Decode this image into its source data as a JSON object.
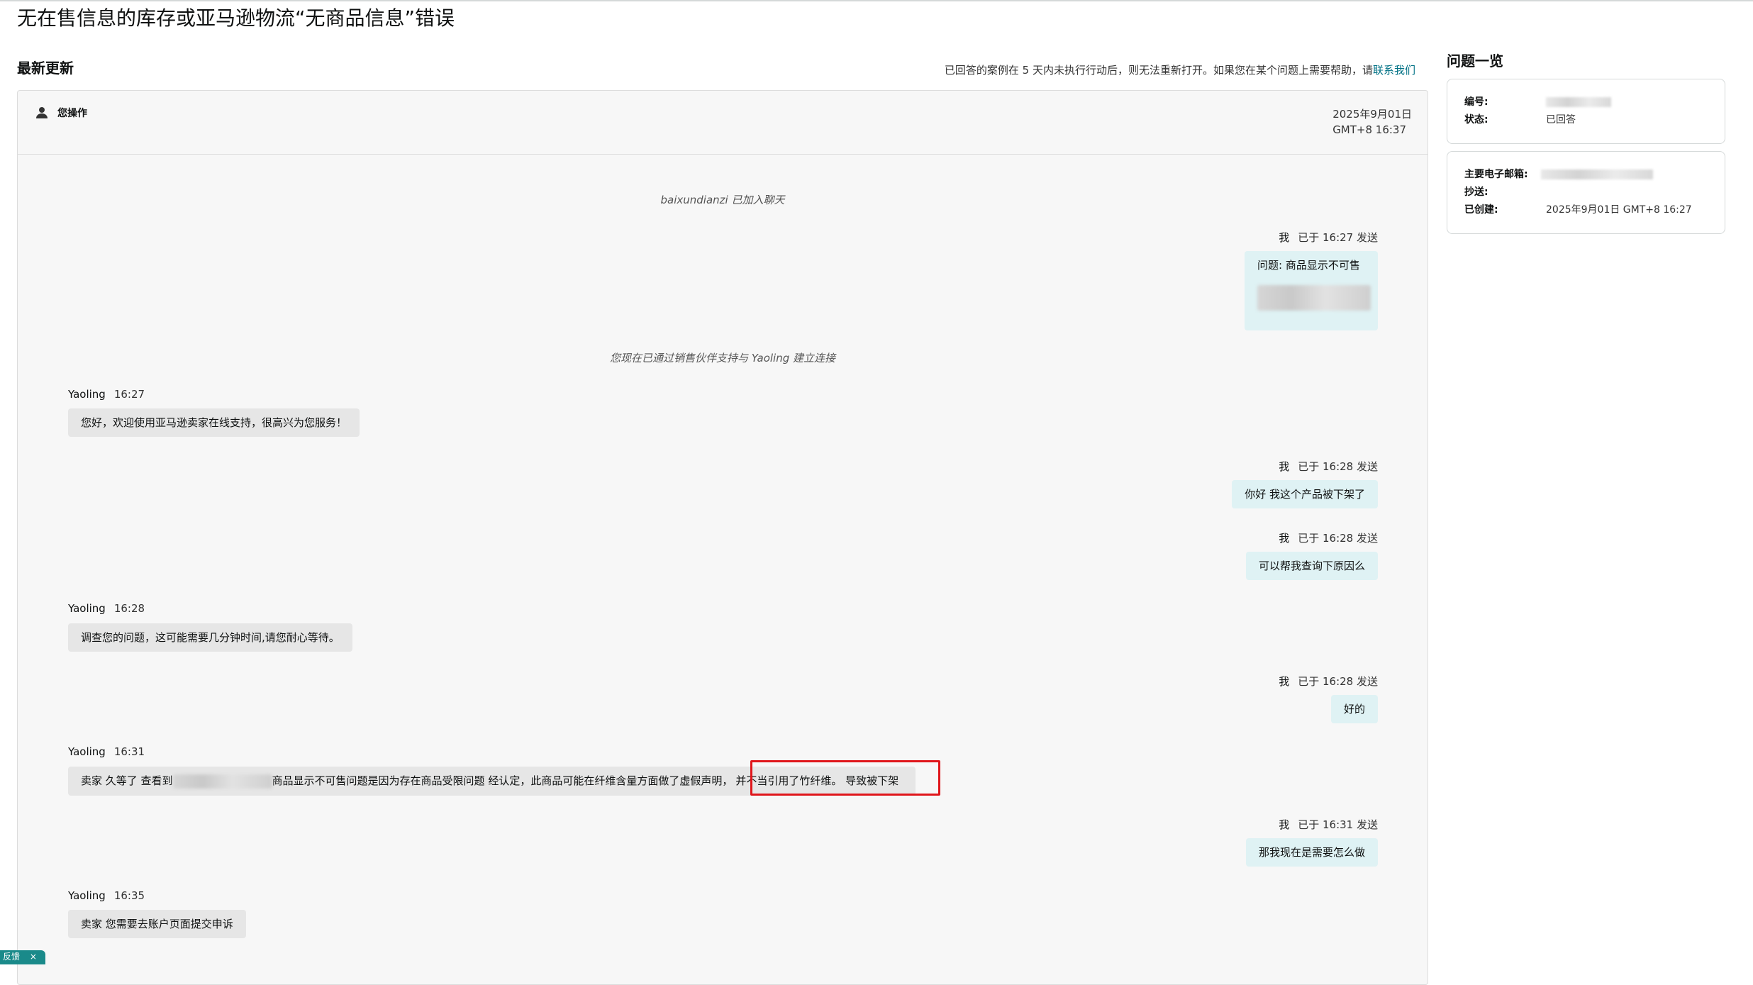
{
  "page": {
    "title": "无在售信息的库存或亚马逊物流“无商品信息”错误"
  },
  "updates": {
    "section_title": "最新更新",
    "notice_text": "已回答的案例在 5 天内未执行行动后，则无法重新打开。如果您在某个问题上需要帮助，请",
    "notice_link": "联系我们"
  },
  "thread": {
    "header_user_icon": "person-icon",
    "header_user_label": "您操作",
    "header_date_line1": "2025年9月01日",
    "header_date_line2": "GMT+8 16:37",
    "system_joined": "baixundianzi 已加入聊天",
    "system_connected": "您现在已通过销售伙伴支持与 Yaoling 建立连接",
    "messages": [
      {
        "sender": "我",
        "time": "已于 16:27 发送",
        "text": "问题: 商品显示不可售",
        "direction": "out"
      },
      {
        "sender": "Yaoling",
        "time": "16:27",
        "text": "您好，欢迎使用亚马逊卖家在线支持，很高兴为您服务！",
        "direction": "in"
      },
      {
        "sender": "我",
        "time": "已于 16:28 发送",
        "text": "你好 我这个产品被下架了",
        "direction": "out"
      },
      {
        "sender": "我",
        "time": "已于 16:28 发送",
        "text": "可以帮我查询下原因么",
        "direction": "out"
      },
      {
        "sender": "Yaoling",
        "time": "16:28",
        "text": "调查您的问题，这可能需要几分钟时间,请您耐心等待。",
        "direction": "in"
      },
      {
        "sender": "我",
        "time": "已于 16:28 发送",
        "text": "好的",
        "direction": "out"
      },
      {
        "sender": "Yaoling",
        "time": "16:31",
        "text_prefix": "卖家 久等了 查看到",
        "text_middle": "商品显示不可售问题是因为存在商品受限问题 经认定，此商品可能在纤维含量方面做了虚假声明，",
        "text_highlight": "并不当引用了竹纤维。 导致被下架",
        "direction": "in"
      },
      {
        "sender": "我",
        "time": "已于 16:31 发送",
        "text": "那我现在是需要怎么做",
        "direction": "out"
      },
      {
        "sender": "Yaoling",
        "time": "16:35",
        "text": "卖家 您需要去账户页面提交申诉",
        "direction": "in"
      }
    ]
  },
  "sidebar": {
    "title": "问题一览",
    "card1": {
      "id_label": "编号:",
      "status_label": "状态:",
      "status_value": "已回答"
    },
    "card2": {
      "email_label": "主要电子邮箱:",
      "cc_label": "抄送:",
      "created_label": "已创建:",
      "created_value": "2025年9月01日 GMT+8 16:27"
    }
  },
  "feedback": {
    "label": "反馈",
    "close_icon": "close-icon"
  },
  "colors": {
    "link": "#007185",
    "outgoing_bubble": "#dff2f4",
    "incoming_bubble": "#e6e6e6",
    "highlight_border": "#e0161b"
  }
}
